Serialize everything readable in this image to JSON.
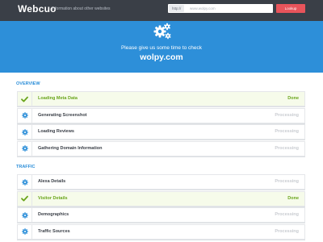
{
  "header": {
    "brand": "Webcuo",
    "tagline": "Information about other websites",
    "url_prefix": "http://",
    "url_placeholder": "www.wolpy.com",
    "lookup_label": "Lookup"
  },
  "banner": {
    "message": "Please give us some time to check",
    "domain": "wolpy.com"
  },
  "sections": [
    {
      "title": "OVERVIEW",
      "items": [
        {
          "label": "Loading Meta Data",
          "status": "Done",
          "icon": "check-icon"
        },
        {
          "label": "Generating Screenshot",
          "status": "Processing",
          "icon": "gear-icon"
        },
        {
          "label": "Loading Reviews",
          "status": "Processing",
          "icon": "gear-icon"
        },
        {
          "label": "Gathering Domain Information",
          "status": "Processing",
          "icon": "gear-icon"
        }
      ]
    },
    {
      "title": "TRAFFIC",
      "items": [
        {
          "label": "Alexa Details",
          "status": "Processing",
          "icon": "gear-icon"
        },
        {
          "label": "Visitor Details",
          "status": "Done",
          "icon": "check-icon"
        },
        {
          "label": "Demographics",
          "status": "Processing",
          "icon": "gear-icon"
        },
        {
          "label": "Traffic Sources",
          "status": "Processing",
          "icon": "gear-icon"
        }
      ]
    }
  ],
  "colors": {
    "topbar": "#3a3f47",
    "banner": "#2d8fd9",
    "accent_blue": "#2d8fd9",
    "lookup": "#e8545b",
    "done_green": "#6aa51c",
    "done_bg": "#f6fbea",
    "processing_gray": "#c9ccd1"
  }
}
